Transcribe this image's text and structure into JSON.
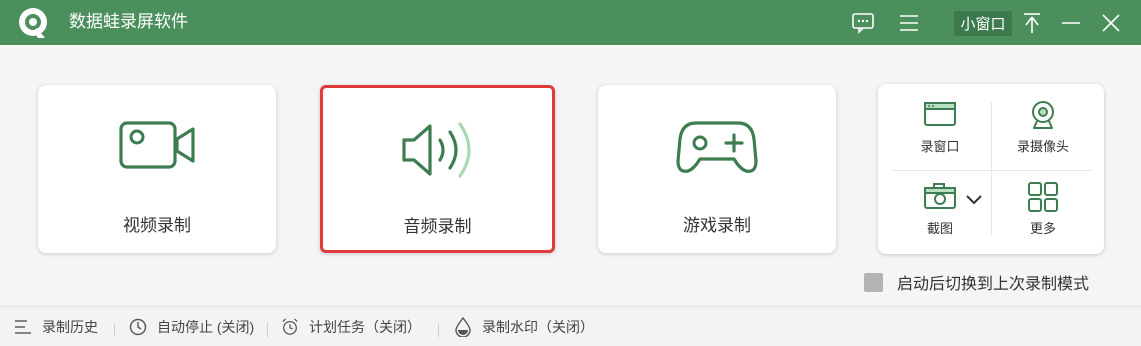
{
  "app": {
    "title": "数据蛙录屏软件"
  },
  "titlebar": {
    "mini_window_label": "小窗口",
    "icons": [
      "feedback-icon",
      "menu-icon",
      "pin-icon",
      "minimize-icon",
      "close-icon"
    ]
  },
  "modes": {
    "video_label": "视频录制",
    "audio_label": "音频录制",
    "game_label": "游戏录制",
    "selected": "audio"
  },
  "tools": {
    "window_label": "录窗口",
    "camera_label": "录摄像头",
    "screenshot_label": "截图",
    "more_label": "更多"
  },
  "options": {
    "restore_last_mode_label": "启动后切换到上次录制模式",
    "restore_last_mode_checked": false
  },
  "footer": {
    "history_label": "录制历史",
    "auto_stop_label": "自动停止 (关闭)",
    "schedule_label": "计划任务（关闭）",
    "watermark_label": "录制水印（关闭）"
  },
  "colors": {
    "brand_green": "#4a8f5c",
    "icon_green": "#3e7d52",
    "selection_red": "#e03a3a"
  }
}
